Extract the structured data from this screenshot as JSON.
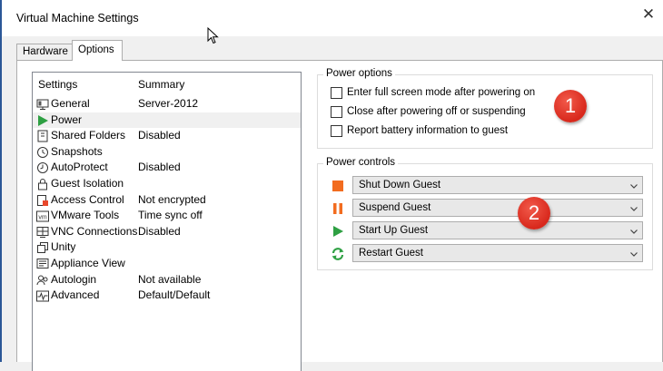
{
  "window": {
    "title": "Virtual Machine Settings"
  },
  "tabs": [
    {
      "label": "Hardware"
    },
    {
      "label": "Options"
    }
  ],
  "settings_list": {
    "header_settings": "Settings",
    "header_summary": "Summary",
    "items": [
      {
        "label": "General",
        "summary": "Server-2012",
        "icon": "monitor-icon"
      },
      {
        "label": "Power",
        "summary": "",
        "icon": "play-icon"
      },
      {
        "label": "Shared Folders",
        "summary": "Disabled",
        "icon": "shared-folder-icon"
      },
      {
        "label": "Snapshots",
        "summary": "",
        "icon": "snapshot-icon"
      },
      {
        "label": "AutoProtect",
        "summary": "Disabled",
        "icon": "clock-icon"
      },
      {
        "label": "Guest Isolation",
        "summary": "",
        "icon": "lock-icon"
      },
      {
        "label": "Access Control",
        "summary": "Not encrypted",
        "icon": "access-control-icon"
      },
      {
        "label": "VMware Tools",
        "summary": "Time sync off",
        "icon": "vm-icon"
      },
      {
        "label": "VNC Connections",
        "summary": "Disabled",
        "icon": "network-icon"
      },
      {
        "label": "Unity",
        "summary": "",
        "icon": "unity-icon"
      },
      {
        "label": "Appliance View",
        "summary": "",
        "icon": "appliance-icon"
      },
      {
        "label": "Autologin",
        "summary": "Not available",
        "icon": "users-icon"
      },
      {
        "label": "Advanced",
        "summary": "Default/Default",
        "icon": "pulse-icon"
      }
    ]
  },
  "power_options": {
    "title": "Power options",
    "checkboxes": [
      {
        "label": "Enter full screen mode after powering on",
        "checked": false
      },
      {
        "label": "Close after powering off or suspending",
        "checked": false
      },
      {
        "label": "Report battery information to guest",
        "checked": false
      }
    ]
  },
  "power_controls": {
    "title": "Power controls",
    "rows": [
      {
        "value": "Shut Down Guest",
        "icon": "stop-icon",
        "color": "#f26c1f"
      },
      {
        "value": "Suspend Guest",
        "icon": "pause-icon",
        "color": "#f26c1f"
      },
      {
        "value": "Start Up Guest",
        "icon": "play-icon",
        "color": "#2ea043"
      },
      {
        "value": "Restart Guest",
        "icon": "refresh-icon",
        "color": "#2ea043"
      }
    ]
  },
  "badges": [
    {
      "label": "1"
    },
    {
      "label": "2"
    }
  ],
  "colors": {
    "badge": "#d8281c",
    "window_border": "#2b5797"
  }
}
